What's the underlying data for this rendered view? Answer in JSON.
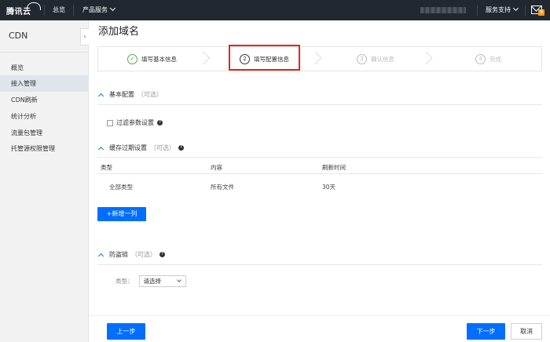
{
  "topbar": {
    "logo_text": "腾讯云",
    "overview": "总览",
    "products": "产品服务",
    "support": "服务支持",
    "mail_badge": "9"
  },
  "sidebar": {
    "title": "CDN",
    "collapse": "‹",
    "items": [
      {
        "label": "概览"
      },
      {
        "label": "接入管理"
      },
      {
        "label": "CDN刷新"
      },
      {
        "label": "统计分析"
      },
      {
        "label": "流量包管理"
      },
      {
        "label": "托管源权限管理"
      }
    ]
  },
  "page": {
    "title": "添加域名"
  },
  "steps": [
    {
      "num": "✓",
      "label": "填写基本信息",
      "state": "done"
    },
    {
      "num": "2",
      "label": "填写配置信息",
      "state": "current"
    },
    {
      "num": "3",
      "label": "确认信息",
      "state": "pending"
    },
    {
      "num": "4",
      "label": "完成",
      "state": "pending"
    }
  ],
  "basic_config": {
    "title": "基本配置",
    "optional": "（可选）",
    "filter_param": "过滤参数设置"
  },
  "cache_config": {
    "title": "缓存过期设置",
    "optional": "（可选）",
    "columns": [
      "类型",
      "内容",
      "刷新时间"
    ],
    "rows": [
      {
        "type": "全部类型",
        "content": "所有文件",
        "time": "30天"
      }
    ],
    "add_button": "+新增一列"
  },
  "hotlink": {
    "title": "防盗链",
    "optional": "（可选）",
    "type_label": "类型：",
    "type_value": "请选择"
  },
  "footer": {
    "prev": "上一步",
    "next": "下一步",
    "cancel": "取消"
  },
  "colors": {
    "primary": "#006eff",
    "topbar": "#21282f",
    "highlight": "#e0261b",
    "done": "#4caf50"
  }
}
